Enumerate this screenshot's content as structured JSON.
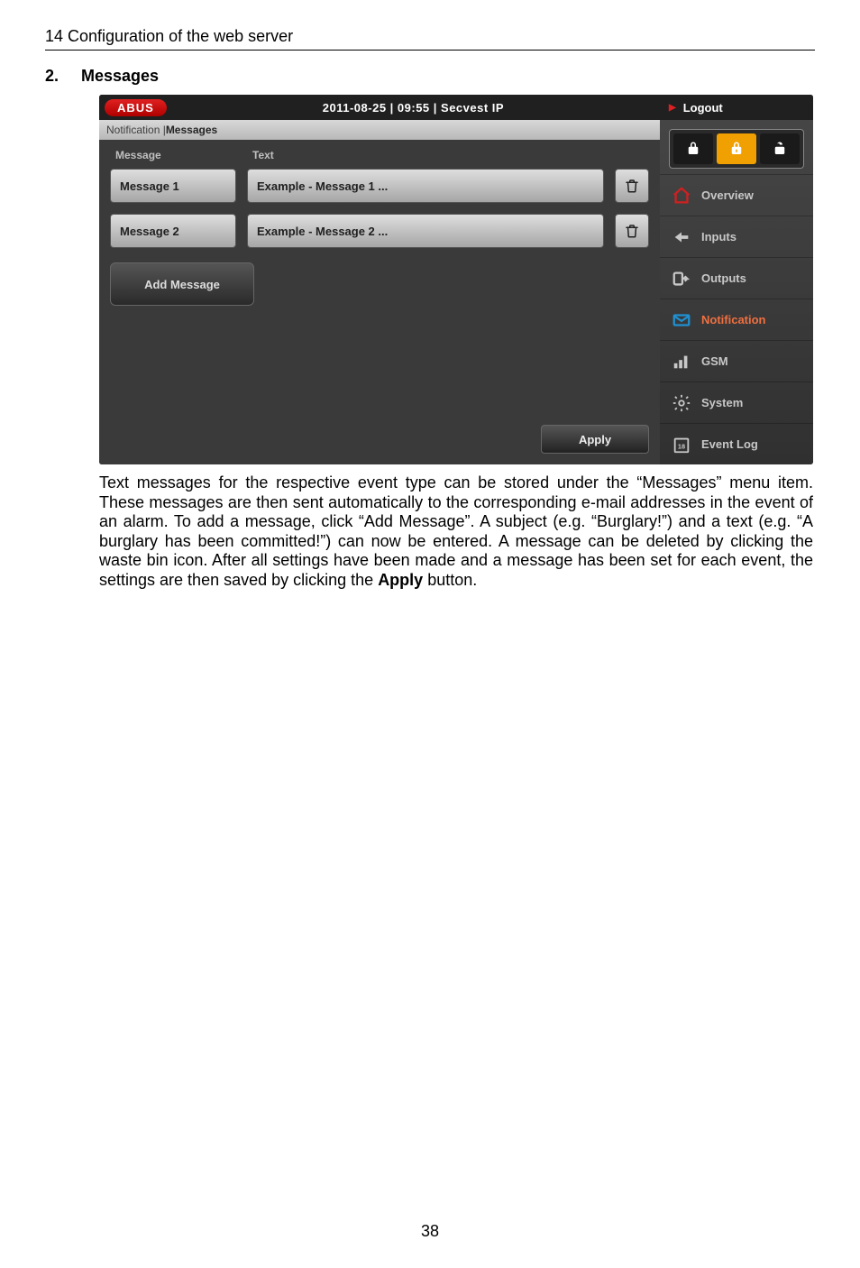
{
  "header": "14  Configuration of the web server",
  "section_number": "2.",
  "section_title": "Messages",
  "screenshot": {
    "logo": "ABUS",
    "date_line": "2011-08-25  |  09:55  |  Secvest IP",
    "breadcrumb_prefix": "Notification | ",
    "breadcrumb_current": "Messages",
    "col_header_message": "Message",
    "col_header_text": "Text",
    "rows": [
      {
        "name": "Message 1",
        "text": "Example - Message 1 ..."
      },
      {
        "name": "Message 2",
        "text": "Example - Message 2 ..."
      }
    ],
    "add_message": "Add Message",
    "apply_label": "Apply",
    "logout": "Logout",
    "nav": {
      "overview": "Overview",
      "inputs": "Inputs",
      "outputs": "Outputs",
      "notification": "Notification",
      "gsm": "GSM",
      "system": "System",
      "event_log": "Event Log"
    }
  },
  "body_text": "Text messages for the respective event type can be stored under the “Messages” menu item. These messages are then sent automatically to the corresponding e-mail addresses in the event of an alarm. To add a message, click “Add Message”. A subject (e.g. “Burglary!”) and a text (e.g. “A burglary has been committed!”) can now be entered. A message can be deleted by clicking the waste bin icon. After all settings have been made and a message has been set for each event, the settings are then saved by clicking the ",
  "body_bold": "Apply",
  "body_tail": " button.",
  "page_number": "38"
}
